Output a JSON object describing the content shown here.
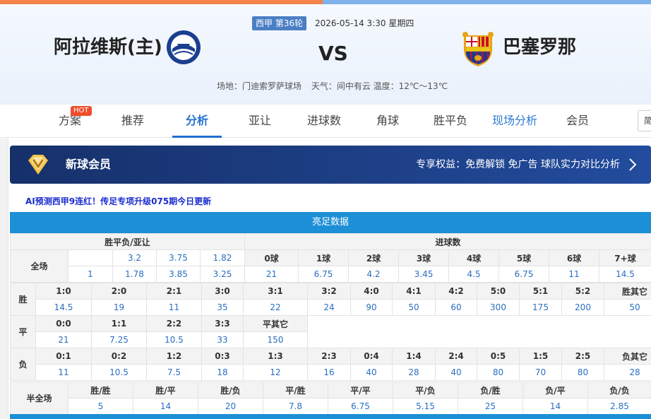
{
  "match": {
    "league_round": "西甲 第36轮",
    "datetime": "2026-05-14 3:30 星期四",
    "home": "阿拉维斯(主)",
    "away": "巴塞罗那",
    "vs": "VS",
    "venue": "场地：门迪索罗萨球场",
    "weather": "天气：间中有云 温度：12℃～13℃"
  },
  "nav": {
    "items": [
      "方案",
      "推荐",
      "分析",
      "亚让",
      "进球数",
      "角球",
      "胜平负",
      "现场分析",
      "会员"
    ],
    "hot": "HOT",
    "edge": "简"
  },
  "vip": {
    "title": "新球会员",
    "benefits": "专享权益：免费解锁 免广告 球队实力对比分析"
  },
  "promo": "AI预测西甲9连红！传足专项升级075期今日更新",
  "table": {
    "title": "亮足数据",
    "head_left": "胜平负/亚让",
    "head_right": "进球数",
    "full_label": "全场",
    "full_row1": [
      "",
      "3.2",
      "3.75",
      "1.82"
    ],
    "full_row2": [
      "1",
      "1.78",
      "3.85",
      "3.25"
    ],
    "goals_labels": [
      "0球",
      "1球",
      "2球",
      "3球",
      "4球",
      "5球",
      "6球",
      "7+球"
    ],
    "goals_values": [
      "21",
      "6.75",
      "4.2",
      "3.45",
      "4.5",
      "6.75",
      "11",
      "14.5"
    ],
    "win_label": "胜",
    "win_scores": [
      "1:0",
      "2:0",
      "2:1",
      "3:0",
      "3:1",
      "3:2",
      "4:0",
      "4:1",
      "4:2",
      "5:0",
      "5:1",
      "5:2",
      "胜其它"
    ],
    "win_odds": [
      "14.5",
      "19",
      "11",
      "35",
      "22",
      "24",
      "90",
      "50",
      "60",
      "300",
      "175",
      "200",
      "50"
    ],
    "draw_label": "平",
    "draw_scores": [
      "0:0",
      "1:1",
      "2:2",
      "3:3",
      "平其它"
    ],
    "draw_odds": [
      "21",
      "7.25",
      "10.5",
      "33",
      "150"
    ],
    "lose_label": "负",
    "lose_scores": [
      "0:1",
      "0:2",
      "1:2",
      "0:3",
      "1:3",
      "2:3",
      "0:4",
      "1:4",
      "2:4",
      "0:5",
      "1:5",
      "2:5",
      "负其它"
    ],
    "lose_odds": [
      "11",
      "10.5",
      "7.5",
      "18",
      "12",
      "16",
      "40",
      "28",
      "40",
      "80",
      "70",
      "80",
      "28"
    ],
    "half_label": "半全场",
    "half_heads": [
      "胜/胜",
      "胜/平",
      "胜/负",
      "平/胜",
      "平/平",
      "平/负",
      "负/胜",
      "负/平",
      "负/负"
    ],
    "half_odds": [
      "5",
      "14",
      "20",
      "7.8",
      "6.75",
      "5.15",
      "25",
      "14",
      "2.85"
    ]
  },
  "colors": {
    "accent": "#1f6fd0",
    "band": "#1d8fd6",
    "vip_bg": "#1d3f86",
    "promo": "#1a2ccf",
    "hot": "#ef4d2a"
  }
}
